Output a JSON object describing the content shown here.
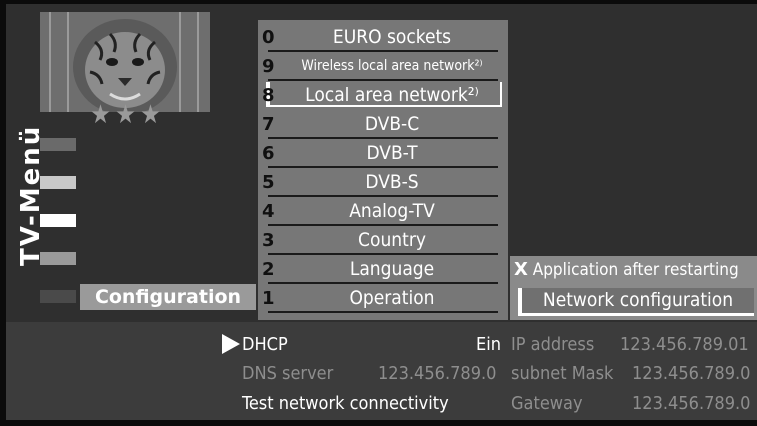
{
  "sidebar": {
    "title": "TV-Menü",
    "rating_stars": "★★★",
    "selected_label": "Configuration"
  },
  "menu": {
    "items": [
      {
        "num": "0",
        "label": "EURO sockets"
      },
      {
        "num": "9",
        "label": "Wireless local area network²⁾"
      },
      {
        "num": "8",
        "label": "Local area network²⁾"
      },
      {
        "num": "7",
        "label": "DVB-C"
      },
      {
        "num": "6",
        "label": "DVB-T"
      },
      {
        "num": "5",
        "label": "DVB-S"
      },
      {
        "num": "4",
        "label": "Analog-TV"
      },
      {
        "num": "3",
        "label": "Country"
      },
      {
        "num": "2",
        "label": "Language"
      },
      {
        "num": "1",
        "label": "Operation"
      }
    ],
    "selected_index": 2
  },
  "submenu": {
    "x_key": "X",
    "row1": "Application after  restarting",
    "row2": "Network configuration"
  },
  "details": {
    "dhcp_label": "DHCP",
    "dhcp_value": "Ein",
    "dns_label": "DNS server",
    "dns_value": "123.456.789.0",
    "test_label": "Test network connectivity",
    "ip_label": "IP address",
    "ip_value": "123.456.789.01",
    "mask_label": "subnet Mask",
    "mask_value": "123.456.789.0",
    "gateway_label": "Gateway",
    "gateway_value": "123.456.789.0"
  },
  "colors": {
    "menu_bg": "#777777",
    "panel_bg": "#3c3c3c",
    "frame_bg": "#2f2f2f",
    "highlight": "#ffffff"
  }
}
